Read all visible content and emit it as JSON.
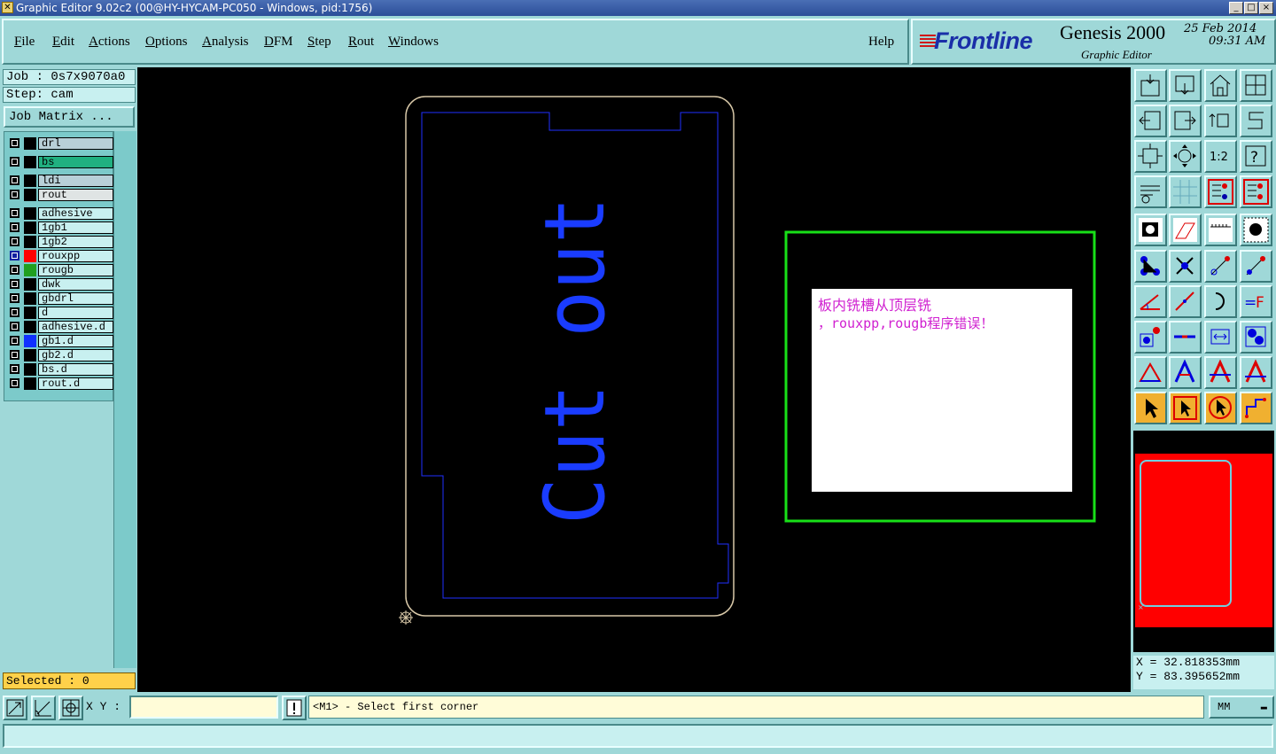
{
  "window": {
    "title": "Graphic Editor 9.02c2 (00@HY-HYCAM-PC050 - Windows, pid:1756)",
    "controls": [
      "_",
      "□",
      "×"
    ]
  },
  "menu": {
    "items": [
      {
        "label": "File",
        "u": "F",
        "rest": "ile"
      },
      {
        "label": "Edit",
        "u": "E",
        "rest": "dit"
      },
      {
        "label": "Actions",
        "u": "A",
        "rest": "ctions"
      },
      {
        "label": "Options",
        "u": "O",
        "rest": "ptions"
      },
      {
        "label": "Analysis",
        "u": "A",
        "rest": "nalysis"
      },
      {
        "label": "DFM",
        "u": "D",
        "rest": "FM"
      },
      {
        "label": "Step",
        "u": "S",
        "rest": "tep"
      },
      {
        "label": "Rout",
        "u": "R",
        "rest": "out"
      },
      {
        "label": "Windows",
        "u": "W",
        "rest": "indows"
      }
    ],
    "help": "Help"
  },
  "brand": {
    "logo": "Frontline",
    "product": "Genesis 2000",
    "subtitle": "Graphic Editor",
    "date": "25 Feb 2014",
    "time": "09:31 AM"
  },
  "left": {
    "job": "Job : 0s7x9070a0",
    "step": "Step: cam",
    "job_matrix": "Job Matrix ...",
    "selected": "Selected : 0"
  },
  "layers": [
    {
      "name": "drl",
      "color": "#000000",
      "bg": "#b8d0d8"
    },
    {
      "name": "bs",
      "color": "#000000",
      "bg": "#20b080"
    },
    {
      "name": "ldi",
      "color": "#000000",
      "bg": "#b8d0d8"
    },
    {
      "name": "rout",
      "color": "#000000",
      "bg": "#dfe4e4"
    },
    {
      "name": "adhesive",
      "color": "#000000",
      "bg": "#c8f0f0"
    },
    {
      "name": "1gb1",
      "color": "#000000",
      "bg": "#c8f0f0"
    },
    {
      "name": "1gb2",
      "color": "#000000",
      "bg": "#c8f0f0"
    },
    {
      "name": "rouxpp",
      "color": "#ff0000",
      "bg": "#c8f0f0",
      "active": true
    },
    {
      "name": "rougb",
      "color": "#20a020",
      "bg": "#c8f0f0"
    },
    {
      "name": "dwk",
      "color": "#000000",
      "bg": "#c8f0f0"
    },
    {
      "name": "gbdrl",
      "color": "#000000",
      "bg": "#c8f0f0"
    },
    {
      "name": "d",
      "color": "#000000",
      "bg": "#c8f0f0"
    },
    {
      "name": "adhesive.d",
      "color": "#000000",
      "bg": "#c8f0f0"
    },
    {
      "name": "gb1.d",
      "color": "#1030ff",
      "bg": "#c8f0f0"
    },
    {
      "name": "gb2.d",
      "color": "#000000",
      "bg": "#c8f0f0"
    },
    {
      "name": "bs.d",
      "color": "#000000",
      "bg": "#c8f0f0"
    },
    {
      "name": "rout.d",
      "color": "#000000",
      "bg": "#c8f0f0"
    }
  ],
  "canvas": {
    "board_text": "Cut out",
    "message_line1": "板内铣槽从顶层铣",
    "message_line2": "，rouxpp,rougb程序错误！",
    "colors": {
      "profile": "#d8c8a8",
      "outline": "#2030ff",
      "text": "#1a3cff",
      "frame": "#18e018",
      "message": "#d020d0"
    }
  },
  "coords": {
    "x": "X = 32.818353mm",
    "y": "Y = 83.395652mm"
  },
  "bottom": {
    "xy_label": "X Y :",
    "xy_value": "",
    "message": "<M1> - Select first corner",
    "units": "MM"
  }
}
